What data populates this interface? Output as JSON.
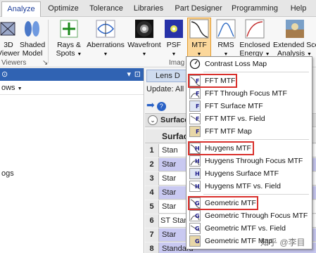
{
  "tabs": [
    "Analyze",
    "Optimize",
    "Tolerance",
    "Libraries",
    "Part Designer",
    "Programming",
    "Help"
  ],
  "ribbon": {
    "buttons": [
      {
        "label1": "3D",
        "label2": "Viewer",
        "icon": "3d-viewer-icon"
      },
      {
        "label1": "Shaded",
        "label2": "Model",
        "icon": "shaded-model-icon"
      },
      {
        "label1": "Rays &",
        "label2": "Spots",
        "icon": "rays-spots-icon"
      },
      {
        "label1": "Aberrations",
        "label2": "",
        "icon": "aberrations-icon"
      },
      {
        "label1": "Wavefront",
        "label2": "",
        "icon": "wavefront-icon"
      },
      {
        "label1": "PSF",
        "label2": "",
        "icon": "psf-icon"
      },
      {
        "label1": "MTF",
        "label2": "",
        "icon": "mtf-icon"
      },
      {
        "label1": "RMS",
        "label2": "",
        "icon": "rms-icon"
      },
      {
        "label1": "Enclosed",
        "label2": "Energy",
        "icon": "enclosed-energy-icon"
      },
      {
        "label1": "Extended Sce",
        "label2": "Analysis",
        "icon": "extended-scene-icon"
      }
    ],
    "group_viewers": "Viewers",
    "group_image": "Imag"
  },
  "left_panel": {
    "sub_label": "ows",
    "item": "ogs"
  },
  "editor": {
    "tab_label": "Lens D",
    "update_label": "Update: All W",
    "surface_label": "Surface",
    "grid_header": "Surfac",
    "rows": [
      {
        "num": "1",
        "val": "Stan"
      },
      {
        "num": "2",
        "val": "Star"
      },
      {
        "num": "3",
        "val": "Star"
      },
      {
        "num": "4",
        "val": "Star"
      },
      {
        "num": "5",
        "val": "Star"
      },
      {
        "num": "6",
        "val": "ST Stan"
      },
      {
        "num": "7",
        "val": "Star"
      },
      {
        "num": "8",
        "val": "Standard"
      }
    ]
  },
  "menu": {
    "items": [
      {
        "label": "Contrast Loss Map",
        "letter": "",
        "icon": "contrast-loss-map-icon"
      },
      {
        "label": "FFT MTF",
        "letter": "F",
        "icon": "fft-mtf-icon"
      },
      {
        "label": "FFT Through Focus MTF",
        "letter": "F",
        "icon": "fft-through-focus-icon"
      },
      {
        "label": "FFT Surface MTF",
        "letter": "F",
        "icon": "fft-surface-icon"
      },
      {
        "label": "FFT MTF vs. Field",
        "letter": "F",
        "icon": "fft-vs-field-icon"
      },
      {
        "label": "FFT MTF Map",
        "letter": "F",
        "icon": "fft-map-icon"
      },
      {
        "label": "Huygens MTF",
        "letter": "H",
        "icon": "huygens-mtf-icon"
      },
      {
        "label": "Huygens Through Focus MTF",
        "letter": "H",
        "icon": "huygens-through-focus-icon"
      },
      {
        "label": "Huygens Surface MTF",
        "letter": "H",
        "icon": "huygens-surface-icon"
      },
      {
        "label": "Huygens MTF vs. Field",
        "letter": "H",
        "icon": "huygens-vs-field-icon"
      },
      {
        "label": "Geometric MTF",
        "letter": "G",
        "icon": "geometric-mtf-icon"
      },
      {
        "label": "Geometric Through Focus MTF",
        "letter": "G",
        "icon": "geometric-through-focus-icon"
      },
      {
        "label": "Geometric MTF vs. Field",
        "letter": "G",
        "icon": "geometric-vs-field-icon"
      },
      {
        "label": "Geometric MTF Map",
        "letter": "G",
        "icon": "geometric-map-icon"
      }
    ]
  },
  "watermark": "知乎 @李目",
  "colors": {
    "highlight": "#fbd79b",
    "highlight_border": "#e39a2c",
    "red_box": "#d9302c",
    "panel_title": "#3063b3",
    "row_alt": "#c9c9f1"
  }
}
